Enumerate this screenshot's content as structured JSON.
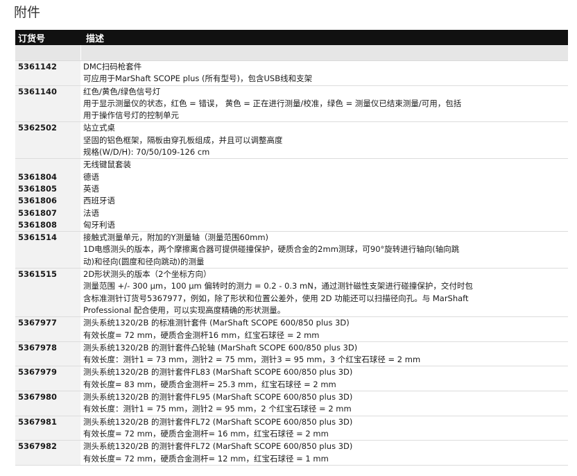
{
  "title": "附件",
  "header": {
    "col_order": "订货号",
    "col_desc": "描述"
  },
  "rows": [
    {
      "codes": [
        "5361142"
      ],
      "lines": [
        "DMC扫码枪套件",
        "可应用于MarShaft SCOPE plus (所有型号)，包含USB线和支架"
      ]
    },
    {
      "codes": [
        "5361140"
      ],
      "lines": [
        "红色/黄色/绿色信号灯",
        "用于显示测量仪的状态，红色 = 错误，  黄色 = 正在进行测量/校准，绿色 = 测量仪已结束测量/可用，包括",
        "用于操作信号灯的控制单元"
      ]
    },
    {
      "codes": [
        "5362502"
      ],
      "lines": [
        "站立式桌",
        "坚固的铝色框架，隔板由穿孔板组成，并且可以调整高度",
        "规格(W/D/H): 70/50/109-126 cm"
      ]
    },
    {
      "codes": [
        "",
        "5361804",
        "5361805",
        "5361806",
        "5361807",
        "5361808"
      ],
      "lines": [
        "无线键鼠套装",
        "德语",
        "英语",
        "西班牙语",
        "法语",
        "匈牙利语"
      ]
    },
    {
      "codes": [
        "5361514"
      ],
      "lines": [
        "接触式测量单元，附加的Y测量轴（测量范围60mm)",
        "1D电感测头的版本，两个摩擦离合器可提供碰撞保护，硬质合金的2mm测球，可90°旋转进行轴向(轴向跳",
        "动)和径向(圆度和径向跳动)的测量"
      ]
    },
    {
      "codes": [
        "5361515"
      ],
      "lines": [
        "2D形状测头的版本（2个坐标方向）",
        "测量范围 +/- 300 µm，100 µm 偏转时的测力 = 0.2 - 0.3 mN，通过测针磁性支架进行碰撞保护，交付时包",
        "含标准测针订货号5367977，例如，除了形状和位置公差外，使用 2D 功能还可以扫描径向孔。与 MarShaft",
        "Professional 配合使用，可以实现高度精确的形状测量。"
      ]
    },
    {
      "codes": [
        "5367977"
      ],
      "lines": [
        "测头系统1320/2B 的标准测针套件 (MarShaft SCOPE 600/850 plus 3D)",
        "有效长度= 72 mm，硬质合金测杆16 mm，红宝石球径 = 2 mm"
      ]
    },
    {
      "codes": [
        "5367978"
      ],
      "lines": [
        "测头系统1320/2B 的测针套件凸轮轴 (MarShaft SCOPE 600/850 plus 3D)",
        "有效长度：测针1 = 73 mm，测针2 = 75 mm，测针3 = 95 mm，3 个红宝石球径 = 2 mm"
      ]
    },
    {
      "codes": [
        "5367979"
      ],
      "lines": [
        "测头系统1320/2B 的测针套件FL83 (MarShaft SCOPE 600/850 plus 3D)",
        "有效长度= 83 mm，硬质合金测杆= 25.3 mm，红宝石球径 = 2 mm"
      ]
    },
    {
      "codes": [
        "5367980"
      ],
      "lines": [
        "测头系统1320/2B 的测针套件FL95 (MarShaft SCOPE 600/850 plus 3D)",
        "有效长度：测针1 = 75 mm，测针2 = 95 mm，2 个红宝石球径 = 2 mm"
      ]
    },
    {
      "codes": [
        "5367981"
      ],
      "lines": [
        "测头系统1320/2B 的测针套件FL72 (MarShaft SCOPE 600/850 plus 3D)",
        "有效长度= 72 mm，硬质合金测杆= 16 mm，红宝石球径 = 2 mm"
      ]
    },
    {
      "codes": [
        "5367982"
      ],
      "lines": [
        "测头系统1320/2B 的测针套件FL72 (MarShaft SCOPE 600/850 plus 3D)",
        "有效长度= 72 mm，硬质合金测杆= 12 mm，红宝石球径 = 1 mm"
      ]
    }
  ]
}
